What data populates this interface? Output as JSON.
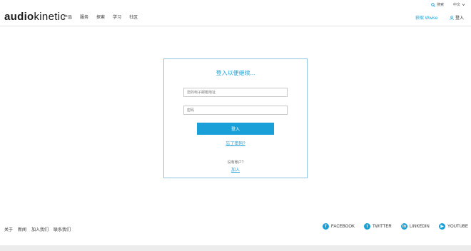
{
  "header": {
    "logo_bold": "audio",
    "logo_thin": "kinetic",
    "nav": [
      "产品",
      "服务",
      "探索",
      "学习",
      "社区"
    ],
    "search_label": "搜索",
    "language": "中文",
    "get_wwise": "获取 Wwise",
    "login": "登入"
  },
  "login_card": {
    "title": "登入以便继续...",
    "email_placeholder": "您的电子邮箱地址",
    "password_placeholder": "密码",
    "submit_label": "登入",
    "forgot": "忘了密码?",
    "no_account": "没有账户?",
    "join": "加入"
  },
  "footer": {
    "links": [
      "关于",
      "新闻",
      "加入我们",
      "联系我们"
    ],
    "social": [
      {
        "label": "FACEBOOK",
        "glyph": "f"
      },
      {
        "label": "TWITTER",
        "glyph": "t"
      },
      {
        "label": "LINKEDIN",
        "glyph": "in"
      },
      {
        "label": "YOUTUBE",
        "glyph": "▶"
      }
    ]
  },
  "colors": {
    "accent": "#1aa0d8",
    "card_border": "#8fc2df"
  }
}
